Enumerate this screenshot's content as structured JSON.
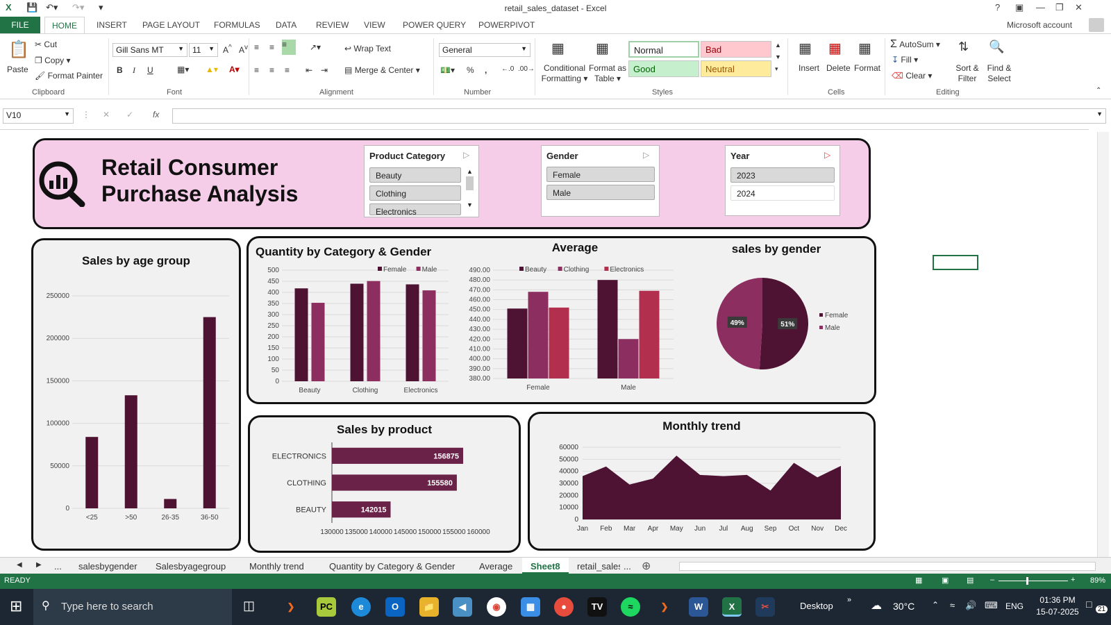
{
  "window": {
    "title": "retail_sales_dataset - Excel",
    "account": "Microsoft account"
  },
  "tabs": [
    "FILE",
    "HOME",
    "INSERT",
    "PAGE LAYOUT",
    "FORMULAS",
    "DATA",
    "REVIEW",
    "VIEW",
    "POWER QUERY",
    "POWERPIVOT"
  ],
  "ribbon": {
    "clipboard": {
      "paste": "Paste",
      "cut": "Cut",
      "copy": "Copy",
      "format_painter": "Format Painter",
      "label": "Clipboard"
    },
    "font": {
      "name": "Gill Sans MT",
      "size": "11",
      "label": "Font",
      "bold": "B",
      "italic": "I",
      "underline": "U"
    },
    "alignment": {
      "wrap": "Wrap Text",
      "merge": "Merge & Center",
      "label": "Alignment"
    },
    "number": {
      "format": "General",
      "label": "Number",
      "percent": "%",
      "comma": ","
    },
    "styles": {
      "cond": "Conditional Formatting",
      "fmt_table": "Format as Table",
      "normal": "Normal",
      "bad": "Bad",
      "good": "Good",
      "neutral": "Neutral",
      "label": "Styles"
    },
    "cells": {
      "insert": "Insert",
      "delete": "Delete",
      "format": "Format",
      "label": "Cells"
    },
    "editing": {
      "autosum": "AutoSum",
      "fill": "Fill",
      "clear": "Clear",
      "sort": "Sort & Filter",
      "find": "Find & Select",
      "label": "Editing"
    }
  },
  "formula_bar": {
    "name_box": "V10",
    "fx": "fx",
    "value": ""
  },
  "dashboard": {
    "title_line1": "Retail Consumer",
    "title_line2": "Purchase Analysis",
    "slicers": {
      "category": {
        "header": "Product Category",
        "items": [
          "Beauty",
          "Clothing",
          "Electronics"
        ]
      },
      "gender": {
        "header": "Gender",
        "items": [
          "Female",
          "Male"
        ]
      },
      "year": {
        "header": "Year",
        "items": [
          "2023",
          "2024"
        ]
      }
    },
    "titles": {
      "age": "Sales by age group",
      "qty": "Quantity by Category & Gender",
      "avg": "Average",
      "gender": "sales by gender",
      "product": "Sales by product",
      "monthly": "Monthly trend"
    }
  },
  "chart_data": [
    {
      "id": "age",
      "type": "bar",
      "title": "Sales by age group",
      "categories": [
        "<25",
        ">50",
        "26-35",
        "36-50"
      ],
      "values": [
        84000,
        133000,
        11000,
        225000
      ],
      "ylim": [
        0,
        250000
      ],
      "yticks": [
        0,
        50000,
        100000,
        150000,
        200000,
        250000
      ],
      "color": "#4e1232"
    },
    {
      "id": "qty",
      "type": "bar",
      "title": "Quantity by Category & Gender",
      "categories": [
        "Beauty",
        "Clothing",
        "Electronics"
      ],
      "series": [
        {
          "name": "Female",
          "values": [
            418,
            439,
            436
          ],
          "color": "#4e1232"
        },
        {
          "name": "Male",
          "values": [
            353,
            451,
            409
          ],
          "color": "#8c2f60"
        }
      ],
      "ylim": [
        0,
        500
      ],
      "yticks": [
        0,
        50,
        100,
        150,
        200,
        250,
        300,
        350,
        400,
        450,
        500
      ]
    },
    {
      "id": "avg",
      "type": "bar",
      "title": "Average",
      "categories": [
        "Female",
        "Male"
      ],
      "series": [
        {
          "name": "Beauty",
          "values": [
            451,
            480
          ],
          "color": "#4e1232"
        },
        {
          "name": "Clothing",
          "values": [
            468,
            420
          ],
          "color": "#8c2f60"
        },
        {
          "name": "Electronics",
          "values": [
            452,
            469
          ],
          "color": "#b2304e"
        }
      ],
      "ylim": [
        380,
        490
      ],
      "yticks": [
        "380.00",
        "390.00",
        "400.00",
        "410.00",
        "420.00",
        "430.00",
        "440.00",
        "450.00",
        "460.00",
        "470.00",
        "480.00",
        "490.00"
      ]
    },
    {
      "id": "gender",
      "type": "pie",
      "title": "sales by gender",
      "categories": [
        "Female",
        "Male"
      ],
      "values": [
        51,
        49
      ],
      "labels": [
        "51%",
        "49%"
      ],
      "colors": [
        "#4e1232",
        "#8c2f60"
      ]
    },
    {
      "id": "product",
      "type": "bar",
      "orientation": "horizontal",
      "title": "Sales by product",
      "categories": [
        "ELECTRONICS",
        "CLOTHING",
        "BEAUTY"
      ],
      "values": [
        156875,
        155580,
        142015
      ],
      "xlim": [
        130000,
        160000
      ],
      "xticks": [
        "130000",
        "135000",
        "140000",
        "145000",
        "150000",
        "155000",
        "160000"
      ],
      "color": "#6b2248"
    },
    {
      "id": "monthly",
      "type": "area",
      "title": "Monthly trend",
      "categories": [
        "Jan",
        "Feb",
        "Mar",
        "Apr",
        "May",
        "Jun",
        "Jul",
        "Aug",
        "Sep",
        "Oct",
        "Nov",
        "Dec"
      ],
      "values": [
        36000,
        44000,
        29000,
        34000,
        53000,
        37000,
        36000,
        37000,
        24000,
        47000,
        35000,
        44500
      ],
      "ylim": [
        0,
        60000
      ],
      "yticks": [
        0,
        10000,
        20000,
        30000,
        40000,
        50000,
        60000
      ],
      "color": "#4e1232"
    }
  ],
  "sheet_tabs": [
    "...",
    "salesbygender",
    "Salesbyagegroup",
    "Monthly trend",
    "Quantity by Category & Gender",
    "Average",
    "Sheet8",
    "retail_sales"
  ],
  "status": {
    "ready": "READY",
    "zoom": "89%"
  },
  "taskbar": {
    "search": "Type here to search",
    "desktop": "Desktop",
    "temp": "30°C",
    "lang": "ENG",
    "time": "01:36 PM",
    "date": "15-07-2025",
    "notif": "21"
  }
}
